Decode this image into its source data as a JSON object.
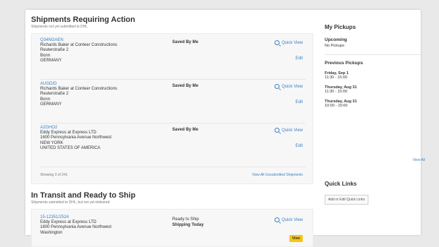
{
  "action": {
    "title": "Shipments Requiring Action",
    "subtitle": "Shipments not yet submitted to DHL",
    "shipments": [
      {
        "id": "Q34NGAEN",
        "lines": [
          "Richards Baker at Conteer Constructions",
          "Reuterstraße 2",
          "Bonn",
          "GERMANY"
        ],
        "status": "Saved By Me",
        "quick_view": "Quick View",
        "edit": "Edit"
      },
      {
        "id": "AUGD/D",
        "lines": [
          "Richards Baker at Conteer Constructions",
          "Reuterstraße 2",
          "Bonn",
          "GERMANY"
        ],
        "status": "Saved By Me",
        "quick_view": "Quick View",
        "edit": "Edit"
      },
      {
        "id": "A2GHO2",
        "lines": [
          "Eddy Express at Express LTD",
          "1600 Pennsylvania Avenue Northwest",
          "NEW YORK",
          "UNITED STATES OF AMERICA"
        ],
        "status": "Saved By Me",
        "quick_view": "Quick View",
        "edit": "Edit"
      }
    ],
    "showing": "Showing 3 of 241",
    "view_all": "View All Unsubmitted Shipments"
  },
  "transit": {
    "title": "In Transit and Ready to Ship",
    "subtitle": "Shipments submitted to DHL, but not yet delivered",
    "shipment": {
      "id": "15-12351/2524",
      "lines": [
        "Eddy Express at Express LTD",
        "1600 Pennsylvania Avenue Northwest",
        "Washington"
      ],
      "status": "Ready to Ship",
      "status2": "Shipping Today",
      "quick_view": "Quick View",
      "view": "View"
    }
  },
  "pickups": {
    "title": "My Pickups",
    "upcoming_label": "Upcoming",
    "upcoming_text": "No Pickups",
    "previous_label": "Previous Pickups",
    "previous": [
      {
        "day": "Friday, Sep 1",
        "time": "11:30 - 15:00"
      },
      {
        "day": "Thursday, Aug 31",
        "time": "11:30 - 15:00"
      },
      {
        "day": "Thursday, Aug 31",
        "time": "10:00 - 15:00"
      }
    ],
    "view_all": "View All"
  },
  "quick_links": {
    "title": "Quick Links",
    "button": "Add or Edit Quick Links"
  },
  "colors": {
    "link": "#3a7fc1",
    "button_yellow": "#f5c518"
  }
}
